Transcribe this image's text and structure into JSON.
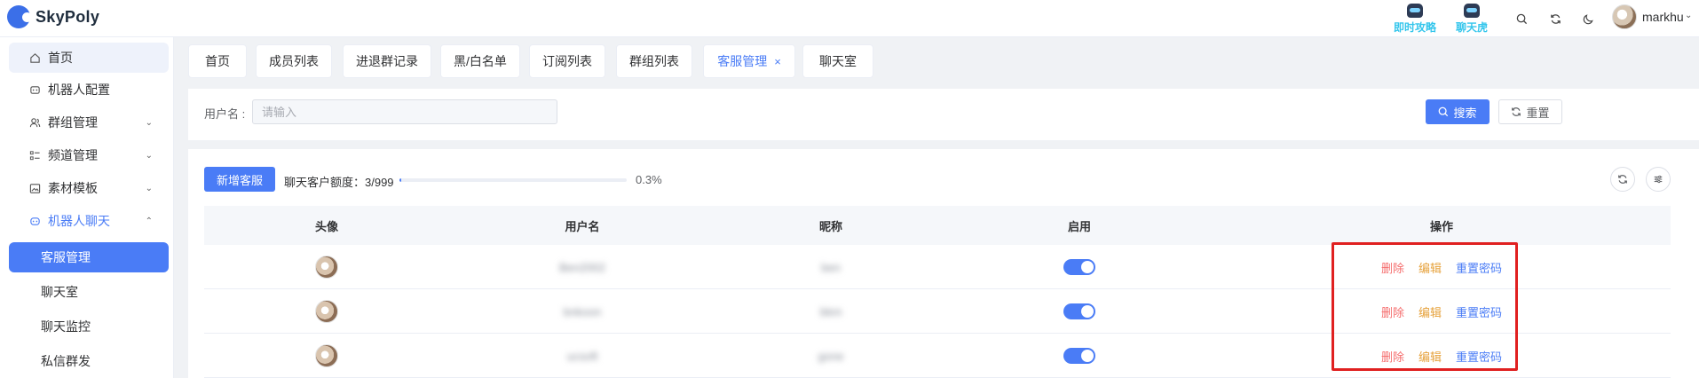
{
  "app": {
    "name": "SkyPoly"
  },
  "header": {
    "promos": [
      {
        "label": "即时攻略"
      },
      {
        "label": "聊天虎"
      }
    ],
    "user": {
      "name": "markhu"
    }
  },
  "sidebar": {
    "items": [
      {
        "label": "首页"
      },
      {
        "label": "机器人配置"
      },
      {
        "label": "群组管理"
      },
      {
        "label": "频道管理"
      },
      {
        "label": "素材模板"
      },
      {
        "label": "机器人聊天"
      }
    ],
    "sub_items": [
      {
        "label": "客服管理"
      },
      {
        "label": "聊天室"
      },
      {
        "label": "聊天监控"
      },
      {
        "label": "私信群发"
      }
    ]
  },
  "tabs": [
    {
      "label": "首页"
    },
    {
      "label": "成员列表"
    },
    {
      "label": "进退群记录"
    },
    {
      "label": "黑/白名单"
    },
    {
      "label": "订阅列表"
    },
    {
      "label": "群组列表"
    },
    {
      "label": "客服管理",
      "close": "×"
    },
    {
      "label": "聊天室"
    }
  ],
  "search": {
    "label": "用户名 :",
    "placeholder": "请输入",
    "value": "",
    "search_label": "搜索",
    "reset_label": "重置"
  },
  "toolbar": {
    "add_label": "新增客服",
    "quota_label": "聊天客户额度：3/999",
    "progress_percent": 0.3,
    "progress_text": "0.3%"
  },
  "table": {
    "columns": [
      "头像",
      "用户名",
      "昵称",
      "启用",
      "操作"
    ],
    "rows": [
      {
        "username": "Ben2002",
        "nickname": "ben",
        "enabled": true
      },
      {
        "username": "bnkoon",
        "nickname": "bkm",
        "enabled": true
      },
      {
        "username": "ucsoft",
        "nickname": "gone",
        "enabled": true
      }
    ],
    "actions": {
      "delete": "删除",
      "edit": "编辑",
      "reset_password": "重置密码"
    }
  },
  "colors": {
    "primary": "#4a7cf6",
    "danger": "#f56c6c",
    "warning": "#e6a23c",
    "highlight": "#e02020"
  }
}
